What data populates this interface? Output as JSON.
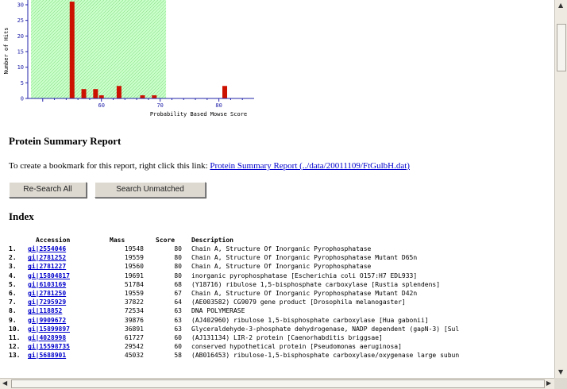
{
  "histogram": {
    "ylabel": "Number of Hits",
    "xlabel": "Probability Based Mowse Score",
    "y_ticks": [
      "0",
      "5",
      "10",
      "15",
      "20",
      "25",
      "30"
    ],
    "x_ticks": [
      "60",
      "70",
      "80"
    ],
    "bar_color": "#cc1100",
    "threshold_fill_color": "#ccffcc"
  },
  "chart_data": {
    "type": "bar",
    "title": "",
    "xlabel": "Probability Based Mowse Score",
    "ylabel": "Number of Hits",
    "ylim": [
      0,
      30
    ],
    "xlim": [
      48,
      86
    ],
    "x": [
      55,
      57,
      59,
      60,
      63,
      67,
      69,
      81
    ],
    "values": [
      31,
      3,
      3,
      1,
      4,
      1,
      1,
      4
    ],
    "threshold_shaded_range": [
      48,
      71
    ]
  },
  "report": {
    "heading": "Protein Summary Report",
    "bookmark_text": "To create a bookmark for this report, right click this link:",
    "bookmark_link": "Protein Summary Report (../data/20011109/FtGulbH.dat)",
    "buttons": {
      "research_all": "Re-Search All",
      "search_unmatched": "Search Unmatched"
    },
    "index_heading": "Index"
  },
  "index": {
    "columns": [
      "Accession",
      "Mass",
      "Score",
      "Description"
    ],
    "rows": [
      {
        "num": "1.",
        "acc": "gi|2554046",
        "mass": "19548",
        "score": "80",
        "desc": "Chain A, Structure Of Inorganic Pyrophosphatase"
      },
      {
        "num": "2.",
        "acc": "gi|2781252",
        "mass": "19559",
        "score": "80",
        "desc": "Chain A, Structure Of Inorganic Pyrophosphatase Mutant D65n"
      },
      {
        "num": "3.",
        "acc": "gi|2781227",
        "mass": "19560",
        "score": "80",
        "desc": "Chain A, Structure Of Inorganic Pyrophosphatase"
      },
      {
        "num": "4.",
        "acc": "gi|15804817",
        "mass": "19691",
        "score": "80",
        "desc": "inorganic pyrophosphatase [Escherichia coli O157:H7 EDL933]"
      },
      {
        "num": "5.",
        "acc": "gi|6103169",
        "mass": "51784",
        "score": "68",
        "desc": "(Y18716) ribulose 1,5-bisphosphate carboxylase [Rustia splendens]"
      },
      {
        "num": "6.",
        "acc": "gi|2781250",
        "mass": "19559",
        "score": "67",
        "desc": "Chain A, Structure Of Inorganic Pyrophosphatase Mutant D42n"
      },
      {
        "num": "7.",
        "acc": "gi|7295929",
        "mass": "37822",
        "score": "64",
        "desc": "(AE003582) CG9079 gene product [Drosophila melanogaster]"
      },
      {
        "num": "8.",
        "acc": "gi|118852",
        "mass": "72534",
        "score": "63",
        "desc": "DNA POLYMERASE"
      },
      {
        "num": "9.",
        "acc": "gi|9909672",
        "mass": "39876",
        "score": "63",
        "desc": "(AJ402960) ribulose 1,5-bisphosphate carboxylase [Hua gabonii]"
      },
      {
        "num": "10.",
        "acc": "gi|15899897",
        "mass": "36891",
        "score": "63",
        "desc": "Glyceraldehyde-3-phosphate dehydrogenase, NADP dependent (gapN-3) [Sul"
      },
      {
        "num": "11.",
        "acc": "gi|4028998",
        "mass": "61727",
        "score": "60",
        "desc": "(AJ131134) LIR-2 protein [Caenorhabditis briggsae]"
      },
      {
        "num": "12.",
        "acc": "gi|15598735",
        "mass": "29542",
        "score": "60",
        "desc": "conserved hypothetical protein [Pseudomonas aeruginosa]"
      },
      {
        "num": "13.",
        "acc": "gi|5688901",
        "mass": "45032",
        "score": "58",
        "desc": "(AB016453) ribulose-1,5-bisphosphate carboxylase/oxygenase large subun"
      }
    ]
  }
}
